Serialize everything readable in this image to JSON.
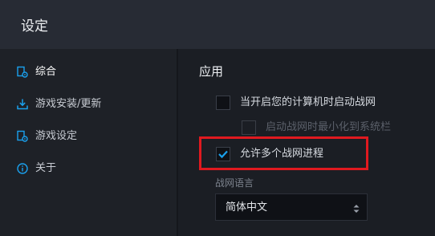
{
  "window": {
    "title": "设定"
  },
  "sidebar": {
    "items": [
      {
        "label": "综合",
        "icon": "general-settings-icon",
        "active": true
      },
      {
        "label": "游戏安装/更新",
        "icon": "download-icon",
        "active": false
      },
      {
        "label": "游戏设定",
        "icon": "game-settings-icon",
        "active": false
      },
      {
        "label": "关于",
        "icon": "info-icon",
        "active": false
      }
    ]
  },
  "main": {
    "section_title": "应用",
    "options": [
      {
        "label": "当开启您的计算机时启动战网",
        "checked": false,
        "enabled": true
      },
      {
        "label": "启动战网时最小化到系统栏",
        "checked": false,
        "enabled": false
      },
      {
        "label": "允许多个战网进程",
        "checked": true,
        "enabled": true
      }
    ],
    "language": {
      "label": "战网语言",
      "value": "简体中文"
    }
  },
  "colors": {
    "accent": "#1aa1ee",
    "highlight_border": "#e0191f",
    "titlebar_bg": "#272b34",
    "sidebar_bg": "#1e2127",
    "main_bg": "#1b1e24"
  }
}
